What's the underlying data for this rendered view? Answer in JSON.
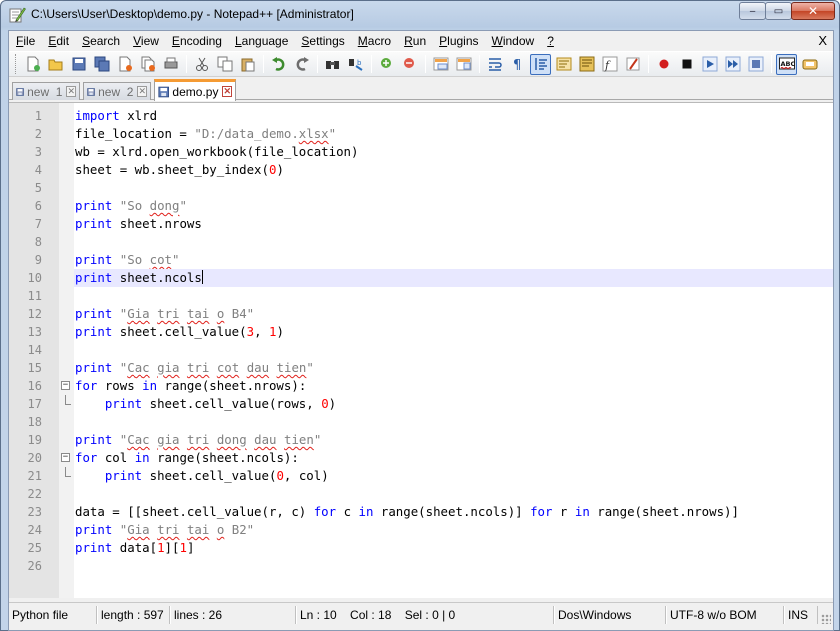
{
  "window": {
    "title": "C:\\Users\\User\\Desktop\\demo.py - Notepad++ [Administrator]",
    "caption": {
      "minimize": "‒",
      "maximize": "▭",
      "close": "✕"
    }
  },
  "menu": {
    "items": [
      {
        "label": "File",
        "u": "F",
        "rest": "ile"
      },
      {
        "label": "Edit",
        "u": "E",
        "rest": "dit"
      },
      {
        "label": "Search",
        "u": "S",
        "rest": "earch"
      },
      {
        "label": "View",
        "u": "V",
        "rest": "iew"
      },
      {
        "label": "Encoding",
        "u": "E",
        "rest": "ncoding"
      },
      {
        "label": "Language",
        "u": "L",
        "rest": "anguage"
      },
      {
        "label": "Settings",
        "u": "S",
        "rest": "ettings"
      },
      {
        "label": "Macro",
        "u": "M",
        "rest": "acro"
      },
      {
        "label": "Run",
        "u": "R",
        "rest": "un"
      },
      {
        "label": "Plugins",
        "u": "P",
        "rest": "lugins"
      },
      {
        "label": "Window",
        "u": "W",
        "rest": "indow"
      },
      {
        "label": "?",
        "u": "?",
        "rest": ""
      }
    ],
    "close": "X"
  },
  "tabs": [
    {
      "label": "new  1",
      "active": false
    },
    {
      "label": "new  2",
      "active": false
    },
    {
      "label": "demo.py",
      "active": true
    }
  ],
  "tab_close_glyph": "✕",
  "editor": {
    "current_line": 10,
    "lines": [
      {
        "n": "1",
        "text": "import xlrd"
      },
      {
        "n": "2",
        "text": "file_location = \"D:/data_demo.xlsx\""
      },
      {
        "n": "3",
        "text": "wb = xlrd.open_workbook(file_location)"
      },
      {
        "n": "4",
        "text": "sheet = wb.sheet_by_index(0)"
      },
      {
        "n": "5",
        "text": ""
      },
      {
        "n": "6",
        "text": "print \"So dong\""
      },
      {
        "n": "7",
        "text": "print sheet.nrows"
      },
      {
        "n": "8",
        "text": ""
      },
      {
        "n": "9",
        "text": "print \"So cot\""
      },
      {
        "n": "10",
        "text": "print sheet.ncols"
      },
      {
        "n": "11",
        "text": ""
      },
      {
        "n": "12",
        "text": "print \"Gia tri tai o B4\""
      },
      {
        "n": "13",
        "text": "print sheet.cell_value(3, 1)"
      },
      {
        "n": "14",
        "text": ""
      },
      {
        "n": "15",
        "text": "print \"Cac gia tri cot dau tien\""
      },
      {
        "n": "16",
        "text": "for rows in range(sheet.nrows):"
      },
      {
        "n": "17",
        "text": "    print sheet.cell_value(rows, 0)"
      },
      {
        "n": "18",
        "text": ""
      },
      {
        "n": "19",
        "text": "print \"Cac gia tri dong dau tien\""
      },
      {
        "n": "20",
        "text": "for col in range(sheet.ncols):"
      },
      {
        "n": "21",
        "text": "    print sheet.cell_value(0, col)"
      },
      {
        "n": "22",
        "text": ""
      },
      {
        "n": "23",
        "text": "data = [[sheet.cell_value(r, c) for c in range(sheet.ncols)] for r in range(sheet.nrows)]"
      },
      {
        "n": "24",
        "text": "print \"Gia tri tai o B2\""
      },
      {
        "n": "25",
        "text": "print data[1][1]"
      },
      {
        "n": "26",
        "text": ""
      }
    ]
  },
  "status": {
    "filetype": "Python file",
    "length": "length : 597",
    "lines": "lines : 26",
    "position": "Ln : 10    Col : 18    Sel : 0 | 0",
    "eol": "Dos\\Windows",
    "encoding": "UTF-8 w/o BOM",
    "mode": "INS"
  },
  "toolbar_icons": [
    "new-file-icon",
    "open-file-icon",
    "save-icon",
    "save-all-icon",
    "close-icon",
    "close-all-icon",
    "print-icon",
    "cut-icon",
    "copy-icon",
    "paste-icon",
    "undo-icon",
    "redo-icon",
    "find-icon",
    "replace-icon",
    "zoom-in-icon",
    "zoom-out-icon",
    "sync-vertical-icon",
    "sync-horizontal-icon",
    "word-wrap-icon",
    "show-all-chars-icon",
    "indent-guide-icon",
    "user-lang-icon",
    "doc-map-icon",
    "function-list-icon",
    "folder-workspace-icon",
    "record-macro-icon",
    "stop-record-icon",
    "play-macro-icon",
    "run-macro-multiple-icon",
    "save-macro-icon",
    "spell-check-icon",
    "spell-options-icon"
  ],
  "colors": {
    "keyword": "#0000ff",
    "string": "#808080",
    "number": "#ff0000",
    "current_line": "#e8e8ff",
    "active_tab_accent": "#f59b34"
  }
}
